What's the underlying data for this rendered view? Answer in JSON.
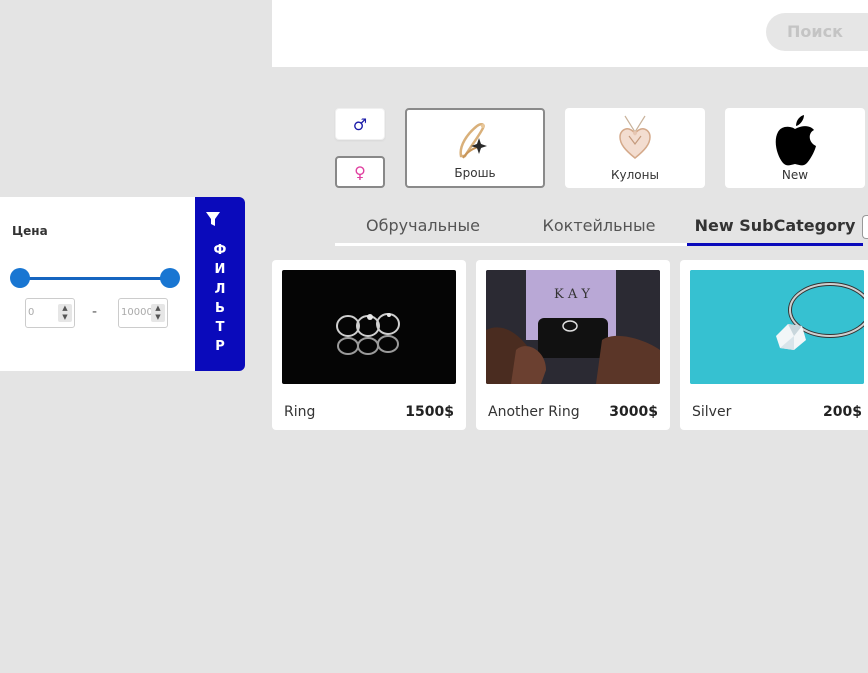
{
  "header": {
    "search_label": "Поиск"
  },
  "gender": {
    "male_icon": "♂",
    "female_icon": "♀"
  },
  "categories": [
    {
      "label": "Брошь",
      "icon": "brooch-icon"
    },
    {
      "label": "Кулоны",
      "icon": "pendant-icon"
    },
    {
      "label": "New",
      "icon": "apple-icon"
    }
  ],
  "tabs": [
    {
      "label": "Обручальные",
      "active": false
    },
    {
      "label": "Коктейльные",
      "active": false
    },
    {
      "label": "New SubCategory",
      "active": true
    }
  ],
  "filter": {
    "price_label": "Цена",
    "min_value": "0",
    "max_value": "10000",
    "dash": "-",
    "tab_letters": [
      "Ф",
      "И",
      "Л",
      "Ь",
      "Т",
      "Р"
    ],
    "accent_color": "#0a0abb",
    "slider_color": "#1976d2"
  },
  "products": [
    {
      "name": "Ring",
      "price": "1500$"
    },
    {
      "name": "Another Ring",
      "price": "3000$"
    },
    {
      "name": "Silver",
      "price": "200$"
    }
  ],
  "colors": {
    "background": "#e4e4e4",
    "tab_active_underline": "#0a0abb"
  }
}
